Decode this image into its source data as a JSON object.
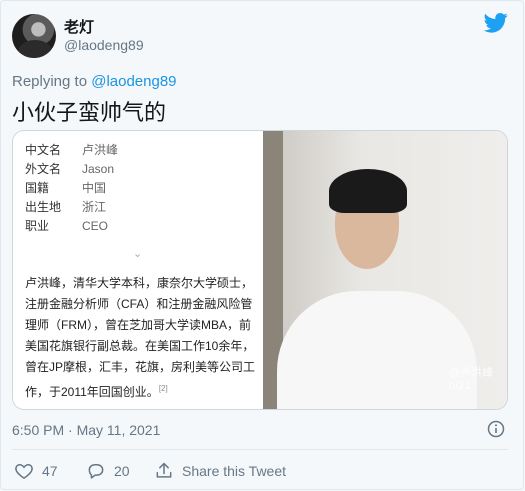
{
  "tweet": {
    "author_name": "老灯",
    "author_handle": "@laodeng89",
    "reply_prefix": "Replying to",
    "reply_handle": "@laodeng89",
    "text": "小伙子蛮帅气的",
    "timestamp": "6:50 PM · May 11, 2021",
    "likes": "47",
    "replies": "20",
    "share_label": "Share this Tweet"
  },
  "media": {
    "rows": [
      {
        "key": "中文名",
        "value": "卢洪峰"
      },
      {
        "key": "外文名",
        "value": "Jason"
      },
      {
        "key": "国籍",
        "value": "中国"
      },
      {
        "key": "出生地",
        "value": "浙江"
      },
      {
        "key": "职业",
        "value": "CEO"
      }
    ],
    "chevron": "⌄",
    "bio": "卢洪峰，清华大学本科，康奈尔大学硕士，注册金融分析师（CFA）和注册金融风险管理师（FRM），曾在芝加哥大学读MBA，前美国花旗银行副总裁。在美国工作10余年，曾在JP摩根，汇丰，花旗，房利美等公司工作，于2011年回国创业。",
    "bio_ref": "[2]",
    "watermark_line1": "@卢洪峰",
    "watermark_line2": "n/21"
  },
  "colors": {
    "link": "#1b95e0",
    "muted": "#657786",
    "twitter_blue": "#1da1f2"
  },
  "icons": {
    "bird": "twitter-bird-icon",
    "info": "info-icon",
    "like": "heart-icon",
    "reply": "reply-icon",
    "share": "share-icon"
  }
}
